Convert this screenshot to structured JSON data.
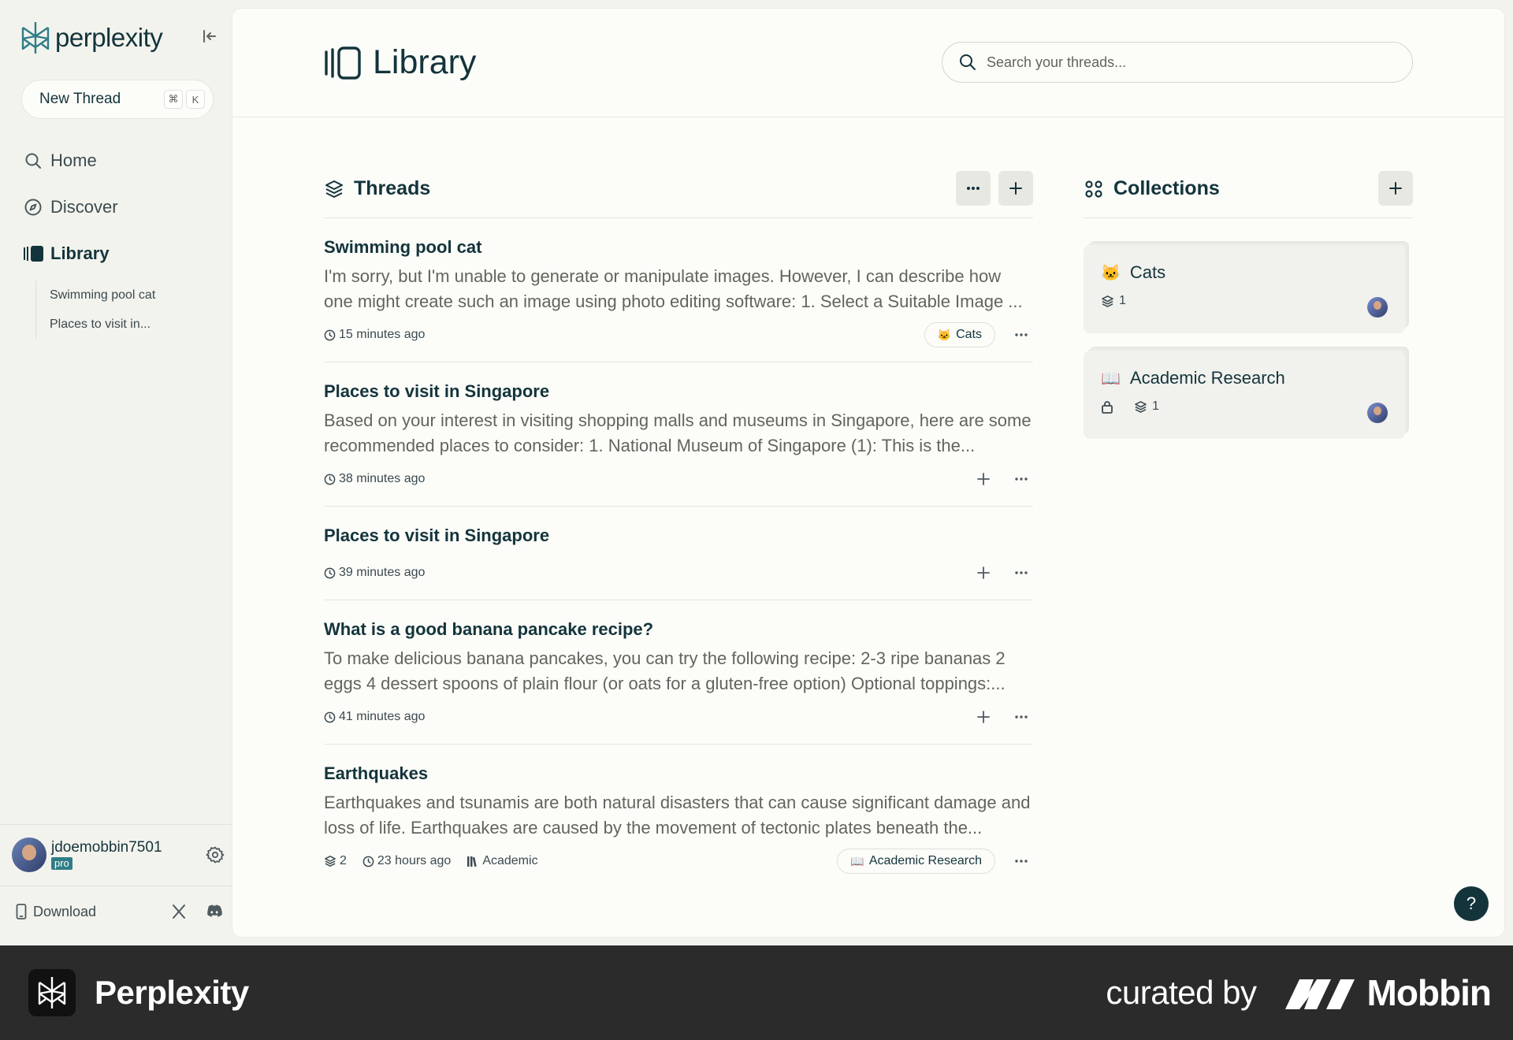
{
  "app": {
    "name": "perplexity"
  },
  "sidebar": {
    "new_thread_label": "New Thread",
    "shortcut_keys": [
      "⌘",
      "K"
    ],
    "nav": [
      {
        "label": "Home",
        "icon": "search-icon"
      },
      {
        "label": "Discover",
        "icon": "compass-icon"
      },
      {
        "label": "Library",
        "icon": "library-icon",
        "active": true
      }
    ],
    "library_items": [
      "Swimming pool cat",
      "Places to visit in..."
    ],
    "user": {
      "username": "jdoemobbin7501",
      "badge": "pro"
    },
    "download_label": "Download"
  },
  "header": {
    "title": "Library",
    "search_placeholder": "Search your threads..."
  },
  "threads": {
    "title": "Threads",
    "items": [
      {
        "title": "Swimming pool cat",
        "snippet": "I'm sorry, but I'm unable to generate or manipulate images. However, I can describe how one might create such an image using photo editing software: 1. Select a Suitable Image ...",
        "time": "15 minutes ago",
        "collection": {
          "emoji": "🐱",
          "label": "Cats"
        }
      },
      {
        "title": "Places to visit in Singapore",
        "snippet": "Based on your interest in visiting shopping malls and museums in Singapore, here are some recommended places to consider: 1. National Museum of Singapore (1): This is the...",
        "time": "38 minutes ago"
      },
      {
        "title": "Places to visit in Singapore",
        "snippet": "",
        "time": "39 minutes ago"
      },
      {
        "title": "What is a good banana pancake recipe?",
        "snippet": "To make delicious banana pancakes, you can try the following recipe: 2-3 ripe bananas 2 eggs 4 dessert spoons of plain flour (or oats for a gluten-free option) Optional toppings:...",
        "time": "41 minutes ago"
      },
      {
        "title": "Earthquakes",
        "snippet": "Earthquakes and tsunamis are both natural disasters that can cause significant damage and loss of life. Earthquakes are caused by the movement of tectonic plates beneath the...",
        "count": "2",
        "time": "23 hours ago",
        "focus": "Academic",
        "collection": {
          "emoji": "📖",
          "label": "Academic Research"
        }
      }
    ]
  },
  "collections": {
    "title": "Collections",
    "items": [
      {
        "emoji": "🐱",
        "name": "Cats",
        "count": "1",
        "private": false
      },
      {
        "emoji": "📖",
        "name": "Academic Research",
        "count": "1",
        "private": true
      }
    ]
  },
  "help_label": "?",
  "footer": {
    "app_name": "Perplexity",
    "curated_by": "curated by",
    "brand": "Mobbin"
  },
  "colors": {
    "brand": "#13343b",
    "accent": "#2f7d87",
    "background": "#f3f3ee",
    "panel": "#fcfcf9"
  }
}
